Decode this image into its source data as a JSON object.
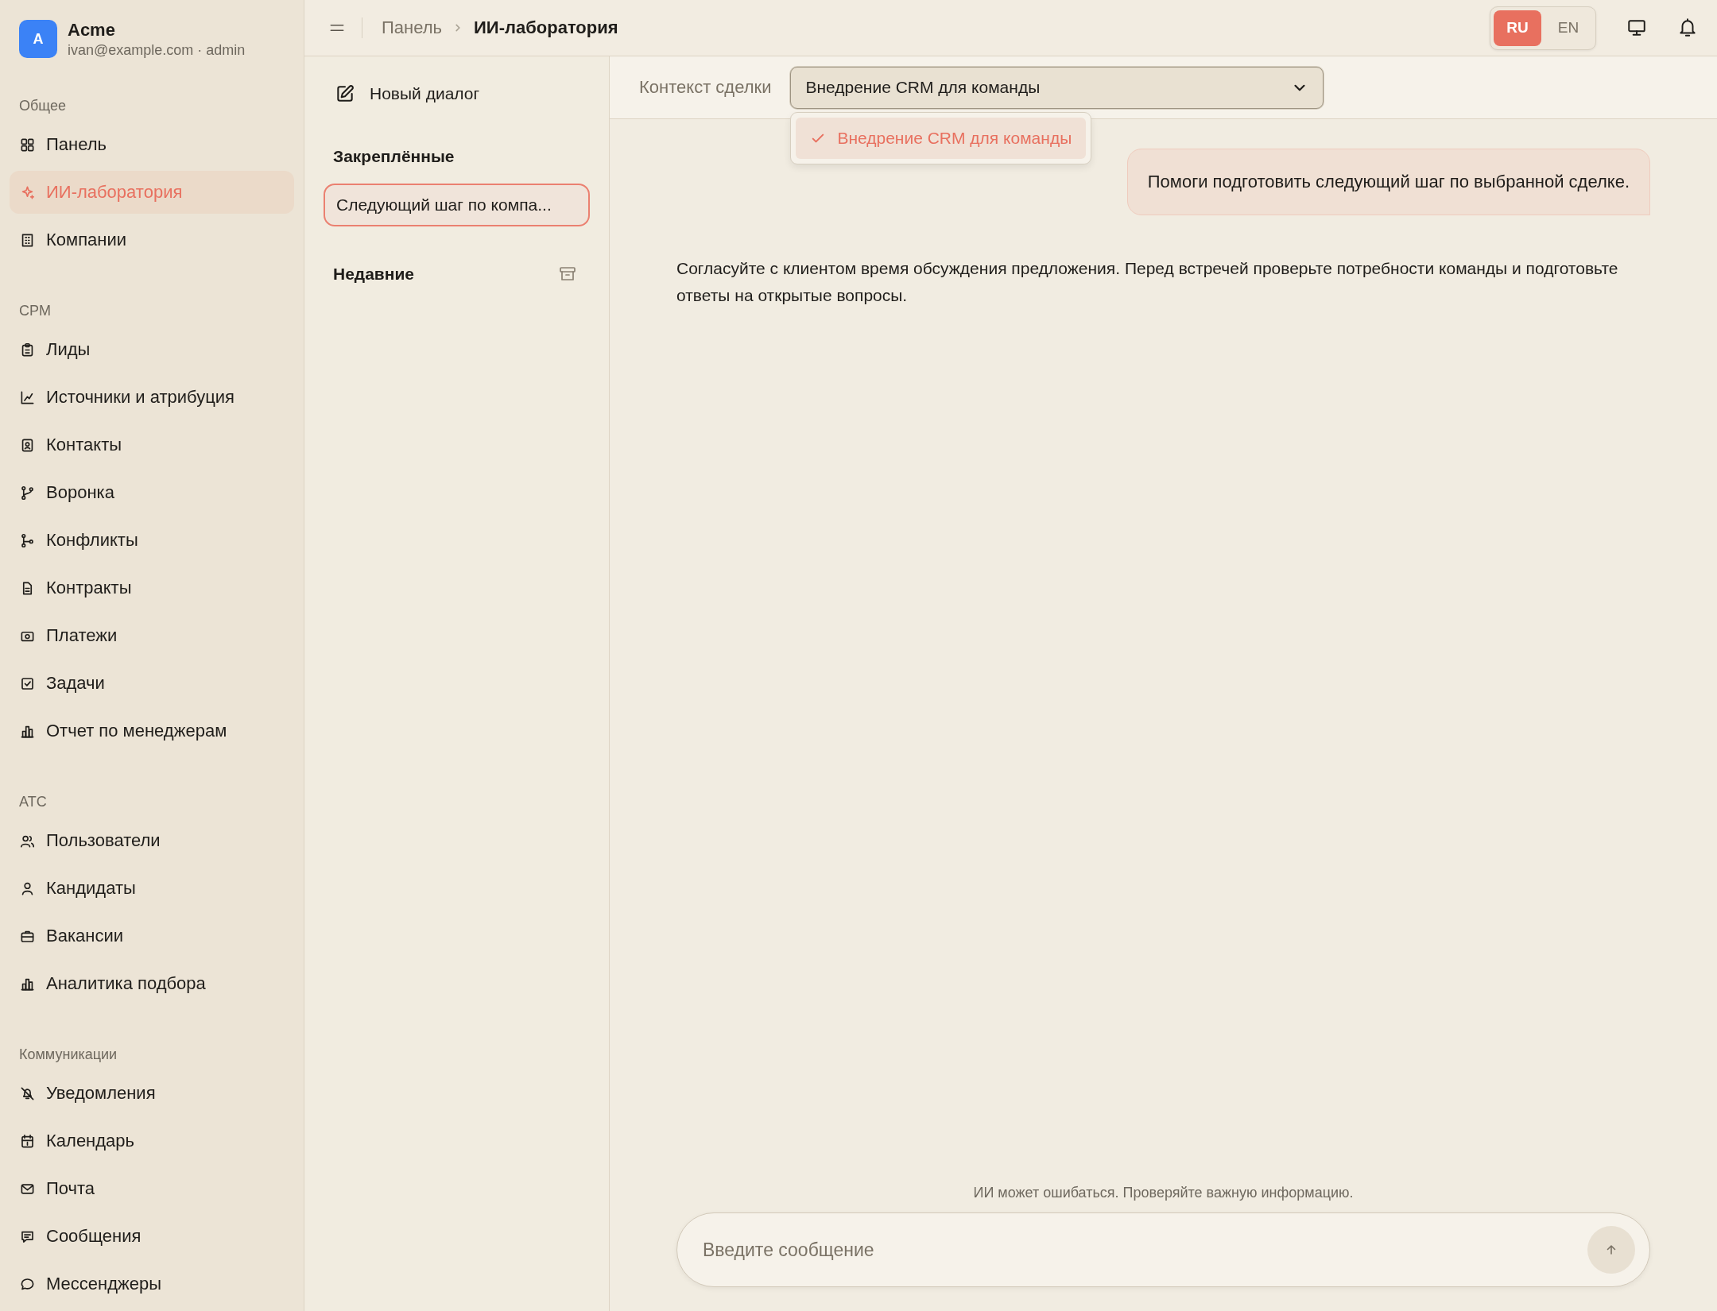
{
  "workspace": {
    "avatar": "A",
    "name": "Acme",
    "subtitle": "ivan@example.com · admin"
  },
  "sidebar": {
    "sections": [
      {
        "title": "Общее",
        "items": [
          {
            "label": "Панель",
            "selected": false
          },
          {
            "label": "ИИ-лаборатория",
            "selected": true
          },
          {
            "label": "Компании",
            "selected": false
          }
        ]
      },
      {
        "title": "CPM",
        "items": [
          {
            "label": "Лиды",
            "selected": false
          },
          {
            "label": "Источники и атрибуция",
            "selected": false
          },
          {
            "label": "Контакты",
            "selected": false
          },
          {
            "label": "Воронка",
            "selected": false
          },
          {
            "label": "Конфликты",
            "selected": false
          },
          {
            "label": "Контракты",
            "selected": false
          },
          {
            "label": "Платежи",
            "selected": false
          },
          {
            "label": "Задачи",
            "selected": false
          },
          {
            "label": "Отчет по менеджерам",
            "selected": false
          }
        ]
      },
      {
        "title": "ATC",
        "items": [
          {
            "label": "Пользователи",
            "selected": false
          },
          {
            "label": "Кандидаты",
            "selected": false
          },
          {
            "label": "Вакансии",
            "selected": false
          },
          {
            "label": "Аналитика подбора",
            "selected": false
          }
        ]
      },
      {
        "title": "Коммуникации",
        "items": [
          {
            "label": "Уведомления",
            "selected": false
          },
          {
            "label": "Календарь",
            "selected": false
          },
          {
            "label": "Почта",
            "selected": false
          },
          {
            "label": "Сообщения",
            "selected": false
          },
          {
            "label": "Мессенджеры",
            "selected": false
          }
        ]
      }
    ]
  },
  "header": {
    "breadcrumb": [
      "Панель",
      "ИИ-лаборатория"
    ],
    "languages": [
      {
        "label": "RU",
        "selected": true
      },
      {
        "label": "EN",
        "selected": false
      }
    ]
  },
  "conversations": {
    "new_dialog": "Новый диалог",
    "pinned_title": "Закреплённые",
    "pinned": [
      {
        "title": "Следующий шаг по компа...",
        "selected": true
      }
    ],
    "recent_title": "Недавние"
  },
  "deal_context": {
    "label": "Контекст сделки",
    "value": "Внедрение CRM для команды",
    "expanded": true,
    "options": [
      {
        "label": "Внедрение CRM для команды",
        "selected": true
      }
    ]
  },
  "messages": [
    {
      "kind": "user",
      "text": "Помоги подготовить следующий шаг по выбранной сделке."
    },
    {
      "kind": "assistant",
      "text": "Согласуйте с клиентом время обсуждения предложения. Перед встречей проверьте потребности команды и подготовьте ответы на открытые вопросы."
    }
  ],
  "composer": {
    "disclaimer": "ИИ может ошибаться. Проверяйте важную информацию.",
    "placeholder": "Введите сообщение"
  }
}
